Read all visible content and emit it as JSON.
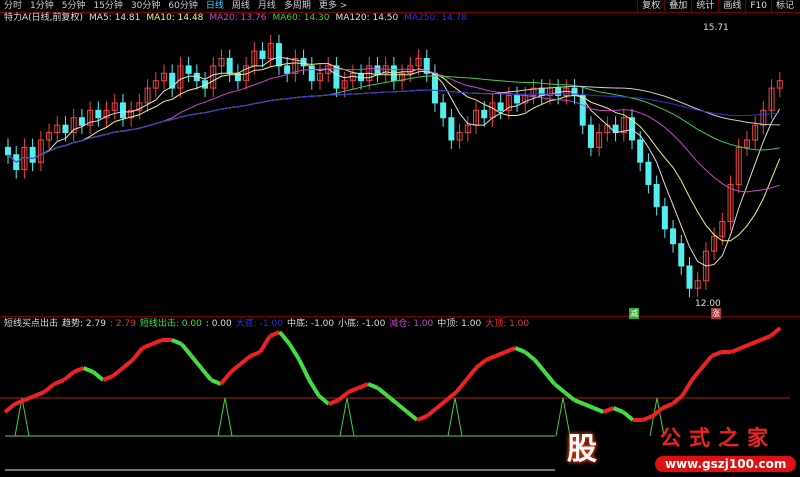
{
  "toolbar": {
    "periods": [
      "分时",
      "1分钟",
      "5分钟",
      "15分钟",
      "30分钟",
      "60分钟",
      "日线",
      "周线",
      "月线",
      "多周期",
      "更多 >"
    ],
    "active": "日线",
    "right": [
      "复权",
      "叠加",
      "统计",
      "画线",
      "F10",
      "标记"
    ]
  },
  "ma_legend": [
    {
      "t": "特力A(日线,前复权)",
      "c": "#ddd"
    },
    {
      "t": "MA5: 14.81",
      "c": "#ddd"
    },
    {
      "t": "MA10: 14.48",
      "c": "#ee8"
    },
    {
      "t": "MA20: 13.76",
      "c": "#c4c"
    },
    {
      "t": "MA60: 14.30",
      "c": "#4c4"
    },
    {
      "t": "MA120: 14.50",
      "c": "#ddd"
    },
    {
      "t": "MA250: 14.78",
      "c": "#33c"
    }
  ],
  "price_labels": {
    "high": "15.71",
    "low": "12.00"
  },
  "markers": {
    "sell": "减",
    "buy": "涨"
  },
  "indicator_legend": [
    {
      "t": "短线买点出击",
      "c": "#ddd"
    },
    {
      "t": "趋势: 2.79",
      "c": "#ddd"
    },
    {
      "t": ": 2.79",
      "c": "#e33"
    },
    {
      "t": "短线出击: 0.00",
      "c": "#4d4"
    },
    {
      "t": ": 0.00",
      "c": "#ddd"
    },
    {
      "t": "大底: -1.00",
      "c": "#33d"
    },
    {
      "t": "中底: -1.00",
      "c": "#ddd"
    },
    {
      "t": "小底: -1.00",
      "c": "#ddd"
    },
    {
      "t": "减仓: 1.00",
      "c": "#c4c"
    },
    {
      "t": "中顶: 1.00",
      "c": "#ddd"
    },
    {
      "t": "大顶: 1.00",
      "c": "#e33"
    }
  ],
  "watermark": {
    "char": "股",
    "name": "公式之家",
    "url": "www.gszj100.com"
  },
  "closes": [
    14.0,
    13.8,
    14.1,
    13.9,
    14.2,
    14.3,
    14.4,
    14.3,
    14.5,
    14.4,
    14.6,
    14.5,
    14.6,
    14.7,
    14.5,
    14.6,
    14.7,
    14.9,
    15.0,
    15.1,
    14.9,
    15.2,
    15.1,
    15.0,
    14.9,
    15.2,
    15.3,
    15.1,
    15.0,
    15.2,
    15.4,
    15.3,
    15.5,
    15.2,
    15.1,
    15.3,
    15.2,
    15.0,
    15.1,
    15.2,
    14.9,
    15.0,
    15.1,
    15.0,
    15.2,
    15.1,
    15.2,
    15.0,
    15.1,
    15.2,
    15.3,
    15.1,
    14.7,
    14.5,
    14.2,
    14.3,
    14.4,
    14.6,
    14.5,
    14.7,
    14.6,
    14.8,
    14.7,
    14.8,
    14.9,
    14.8,
    14.9,
    14.8,
    14.9,
    14.8,
    14.4,
    14.1,
    14.3,
    14.4,
    14.3,
    14.5,
    14.2,
    13.9,
    13.6,
    13.3,
    13.0,
    12.8,
    12.5,
    12.2,
    12.3,
    12.7,
    12.9,
    13.1,
    13.6,
    14.1,
    14.2,
    14.4,
    14.6,
    14.9,
    15.0
  ],
  "trend": [
    1.2,
    1.4,
    1.5,
    1.6,
    1.7,
    1.9,
    2.0,
    2.2,
    2.3,
    2.2,
    2.0,
    2.1,
    2.3,
    2.5,
    2.8,
    2.9,
    3.0,
    3.0,
    2.9,
    2.6,
    2.3,
    2.0,
    1.9,
    2.2,
    2.4,
    2.6,
    2.7,
    3.1,
    3.2,
    2.9,
    2.5,
    2.0,
    1.6,
    1.4,
    1.5,
    1.7,
    1.8,
    1.9,
    1.8,
    1.6,
    1.4,
    1.2,
    1.0,
    1.1,
    1.3,
    1.5,
    1.7,
    2.0,
    2.3,
    2.5,
    2.6,
    2.7,
    2.8,
    2.7,
    2.5,
    2.2,
    1.9,
    1.7,
    1.5,
    1.4,
    1.3,
    1.2,
    1.3,
    1.2,
    1.0,
    1.0,
    1.1,
    1.3,
    1.4,
    1.6,
    2.0,
    2.3,
    2.6,
    2.7,
    2.7,
    2.8,
    2.9,
    3.0,
    3.1,
    3.3
  ]
}
